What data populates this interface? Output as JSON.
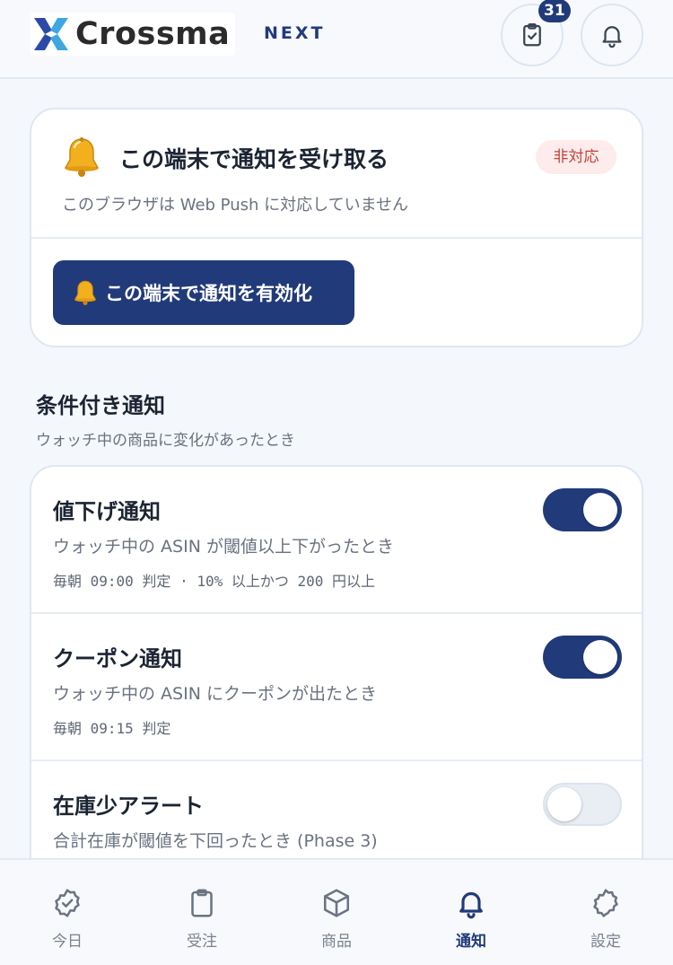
{
  "header": {
    "logo_text": "Crossma",
    "logo_suffix": "NEXT",
    "tasks_badge": "31",
    "tasks_icon": "clipboard-check-icon",
    "bell_icon": "bell-icon"
  },
  "push_card": {
    "title": "この端末で通知を受け取る",
    "status": "非対応",
    "description": "このブラウザは Web Push に対応していません",
    "enable_button": "この端末で通知を有効化"
  },
  "conditional": {
    "title": "条件付き通知",
    "subtitle": "ウォッチ中の商品に変化があったとき",
    "items": [
      {
        "title": "値下げ通知",
        "description": "ウォッチ中の ASIN が閾値以上下がったとき",
        "meta": "毎朝 09:00 判定 · 10% 以上かつ 200 円以上",
        "enabled": true
      },
      {
        "title": "クーポン通知",
        "description": "ウォッチ中の ASIN にクーポンが出たとき",
        "meta": "毎朝 09:15 判定",
        "enabled": true
      },
      {
        "title": "在庫少アラート",
        "description": "合計在庫が閾値を下回ったとき (Phase 3)",
        "enabled": false
      }
    ]
  },
  "nav": {
    "items": [
      {
        "label": "今日",
        "icon": "check-badge-icon"
      },
      {
        "label": "受注",
        "icon": "clipboard-icon"
      },
      {
        "label": "商品",
        "icon": "box-icon"
      },
      {
        "label": "通知",
        "icon": "bell-icon",
        "active": true
      },
      {
        "label": "設定",
        "icon": "gear-icon"
      }
    ]
  },
  "colors": {
    "accent": "#213a7a",
    "danger_bg": "#fdeceb",
    "danger_text": "#c44238"
  }
}
